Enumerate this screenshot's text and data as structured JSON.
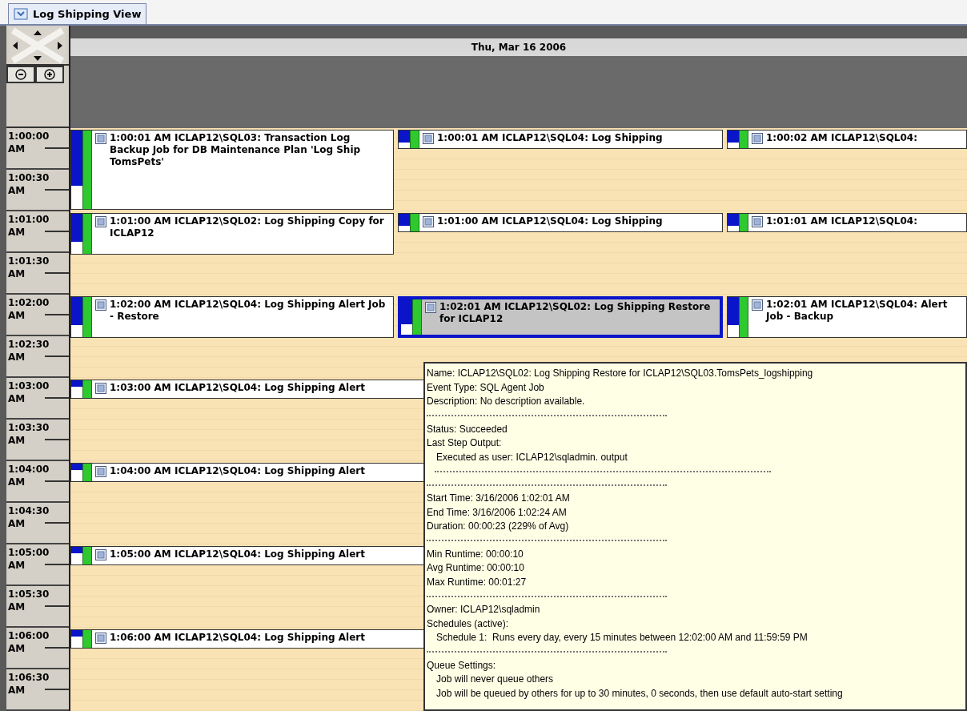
{
  "tab": {
    "label": "Log Shipping View",
    "selected": true
  },
  "date_header": "Thu, Mar 16 2006",
  "time_slots": [
    "1:00:00 AM",
    "1:00:30 AM",
    "1:01:00 AM",
    "1:01:30 AM",
    "1:02:00 AM",
    "1:02:30 AM",
    "1:03:00 AM",
    "1:03:30 AM",
    "1:04:00 AM",
    "1:04:30 AM",
    "1:05:00 AM",
    "1:05:30 AM",
    "1:06:00 AM",
    "1:06:30 AM"
  ],
  "minutes": [
    {
      "events": [
        {
          "kind": "tall",
          "selected": false,
          "text": "1:00:01 AM  ICLAP12\\SQL03: Transaction Log Backup Job for DB Maintenance Plan 'Log Ship TomsPets'"
        },
        {
          "kind": "line",
          "selected": false,
          "text": "1:00:01 AM  ICLAP12\\SQL04: Log Shipping"
        },
        {
          "kind": "line",
          "selected": false,
          "text": "1:00:02 AM  ICLAP12\\SQL04:"
        }
      ]
    },
    {
      "events": [
        {
          "kind": "medium",
          "selected": false,
          "text": "1:01:00 AM  ICLAP12\\SQL02: Log Shipping Copy for ICLAP12"
        },
        {
          "kind": "line",
          "selected": false,
          "text": "1:01:00 AM  ICLAP12\\SQL04: Log Shipping"
        },
        {
          "kind": "line",
          "selected": false,
          "text": "1:01:01 AM  ICLAP12\\SQL04:"
        }
      ]
    },
    {
      "events": [
        {
          "kind": "medium",
          "selected": false,
          "text": "1:02:00 AM  ICLAP12\\SQL04: Log Shipping Alert Job - Restore"
        },
        {
          "kind": "medium",
          "selected": true,
          "text": "1:02:01 AM  ICLAP12\\SQL02: Log Shipping Restore for ICLAP12"
        },
        {
          "kind": "medium",
          "selected": false,
          "text": "1:02:01 AM  ICLAP12\\SQL04: Alert Job - Backup"
        }
      ]
    },
    {
      "events": [
        {
          "kind": "wide",
          "selected": false,
          "text": "1:03:00 AM  ICLAP12\\SQL04: Log Shipping Alert"
        }
      ]
    },
    {
      "events": [
        {
          "kind": "wide",
          "selected": false,
          "text": "1:04:00 AM  ICLAP12\\SQL04: Log Shipping Alert"
        }
      ]
    },
    {
      "events": [
        {
          "kind": "wide",
          "selected": false,
          "text": "1:05:00 AM  ICLAP12\\SQL04: Log Shipping Alert"
        }
      ]
    },
    {
      "events": [
        {
          "kind": "wide",
          "selected": false,
          "text": "1:06:00 AM  ICLAP12\\SQL04: Log Shipping Alert"
        }
      ]
    }
  ],
  "tooltip": {
    "lines": [
      {
        "kind": "text",
        "text": "Name: ICLAP12\\SQL02: Log Shipping Restore for ICLAP12\\SQL03.TomsPets_logshipping"
      },
      {
        "kind": "text",
        "text": "Event Type: SQL Agent Job"
      },
      {
        "kind": "text",
        "text": "Description: No description available."
      },
      {
        "kind": "rule"
      },
      {
        "kind": "text",
        "text": "Status: Succeeded"
      },
      {
        "kind": "text",
        "text": "Last Step Output:"
      },
      {
        "kind": "indent",
        "text": "Executed as user: ICLAP12\\sqladmin. output"
      },
      {
        "kind": "long-rule"
      },
      {
        "kind": "rule"
      },
      {
        "kind": "text",
        "text": "Start Time: 3/16/2006 1:02:01 AM"
      },
      {
        "kind": "text",
        "text": "End Time: 3/16/2006 1:02:24 AM"
      },
      {
        "kind": "text",
        "text": "Duration: 00:00:23 (229% of Avg)"
      },
      {
        "kind": "rule"
      },
      {
        "kind": "text",
        "text": "Min Runtime: 00:00:10"
      },
      {
        "kind": "text",
        "text": "Avg Runtime: 00:00:10"
      },
      {
        "kind": "text",
        "text": "Max Runtime: 00:01:27"
      },
      {
        "kind": "rule"
      },
      {
        "kind": "text",
        "text": "Owner: ICLAP12\\sqladmin"
      },
      {
        "kind": "text",
        "text": "Schedules (active):"
      },
      {
        "kind": "indent",
        "text": "Schedule 1:  Runs every day, every 15 minutes between 12:02:00 AM and 11:59:59 PM"
      },
      {
        "kind": "rule"
      },
      {
        "kind": "text",
        "text": "Queue Settings:"
      },
      {
        "kind": "indent",
        "text": "Job will never queue others"
      },
      {
        "kind": "indent",
        "text": "Job will be queued by others for up to 30 minutes, 0 seconds, then use default auto-start setting"
      }
    ]
  }
}
